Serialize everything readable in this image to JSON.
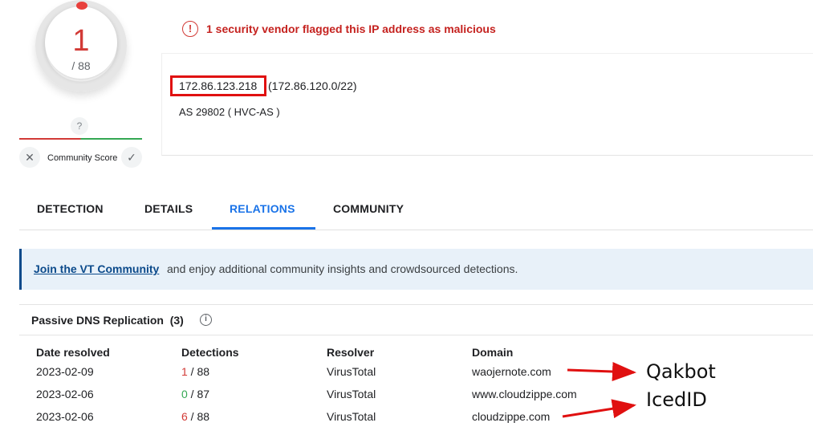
{
  "score": {
    "detections": "1",
    "total": "/ 88",
    "community_question": "?",
    "community_label": "Community Score",
    "downvote_glyph": "✕",
    "upvote_glyph": "✓"
  },
  "alert": {
    "icon_glyph": "!",
    "text": "1 security vendor flagged this IP address as malicious",
    "color": "#c5221f"
  },
  "ip": {
    "address": "172.86.123.218",
    "range": "(172.86.120.0/22)",
    "as": "AS 29802 ( HVC-AS )"
  },
  "tabs": [
    {
      "label": "DETECTION",
      "active": false
    },
    {
      "label": "DETAILS",
      "active": false
    },
    {
      "label": "RELATIONS",
      "active": true
    },
    {
      "label": "COMMUNITY",
      "active": false
    }
  ],
  "banner": {
    "link": "Join the VT Community",
    "text": "and enjoy additional community insights and crowdsourced detections."
  },
  "passive_dns": {
    "title": "Passive DNS Replication",
    "count": "(3)",
    "info_glyph": "i",
    "columns": [
      "Date resolved",
      "Detections",
      "Resolver",
      "Domain"
    ],
    "rows": [
      {
        "date": "2023-02-09",
        "det_num": "1",
        "det_total": " / 88",
        "resolver": "VirusTotal",
        "domain": "waojernote.com",
        "status": "bad"
      },
      {
        "date": "2023-02-06",
        "det_num": "0",
        "det_total": " / 87",
        "resolver": "VirusTotal",
        "domain": "www.cloudzippe.com",
        "status": "good"
      },
      {
        "date": "2023-02-06",
        "det_num": "6",
        "det_total": " / 88",
        "resolver": "VirusTotal",
        "domain": "cloudzippe.com",
        "status": "bad"
      }
    ]
  },
  "annotations": {
    "label_1": "Qakbot",
    "label_2": "IcedID",
    "arrow_color": "#e01010"
  },
  "colors": {
    "accent": "#1a73e8",
    "malicious": "#d23a36",
    "clean": "#34a853",
    "banner_bg": "#e8f1f9"
  }
}
